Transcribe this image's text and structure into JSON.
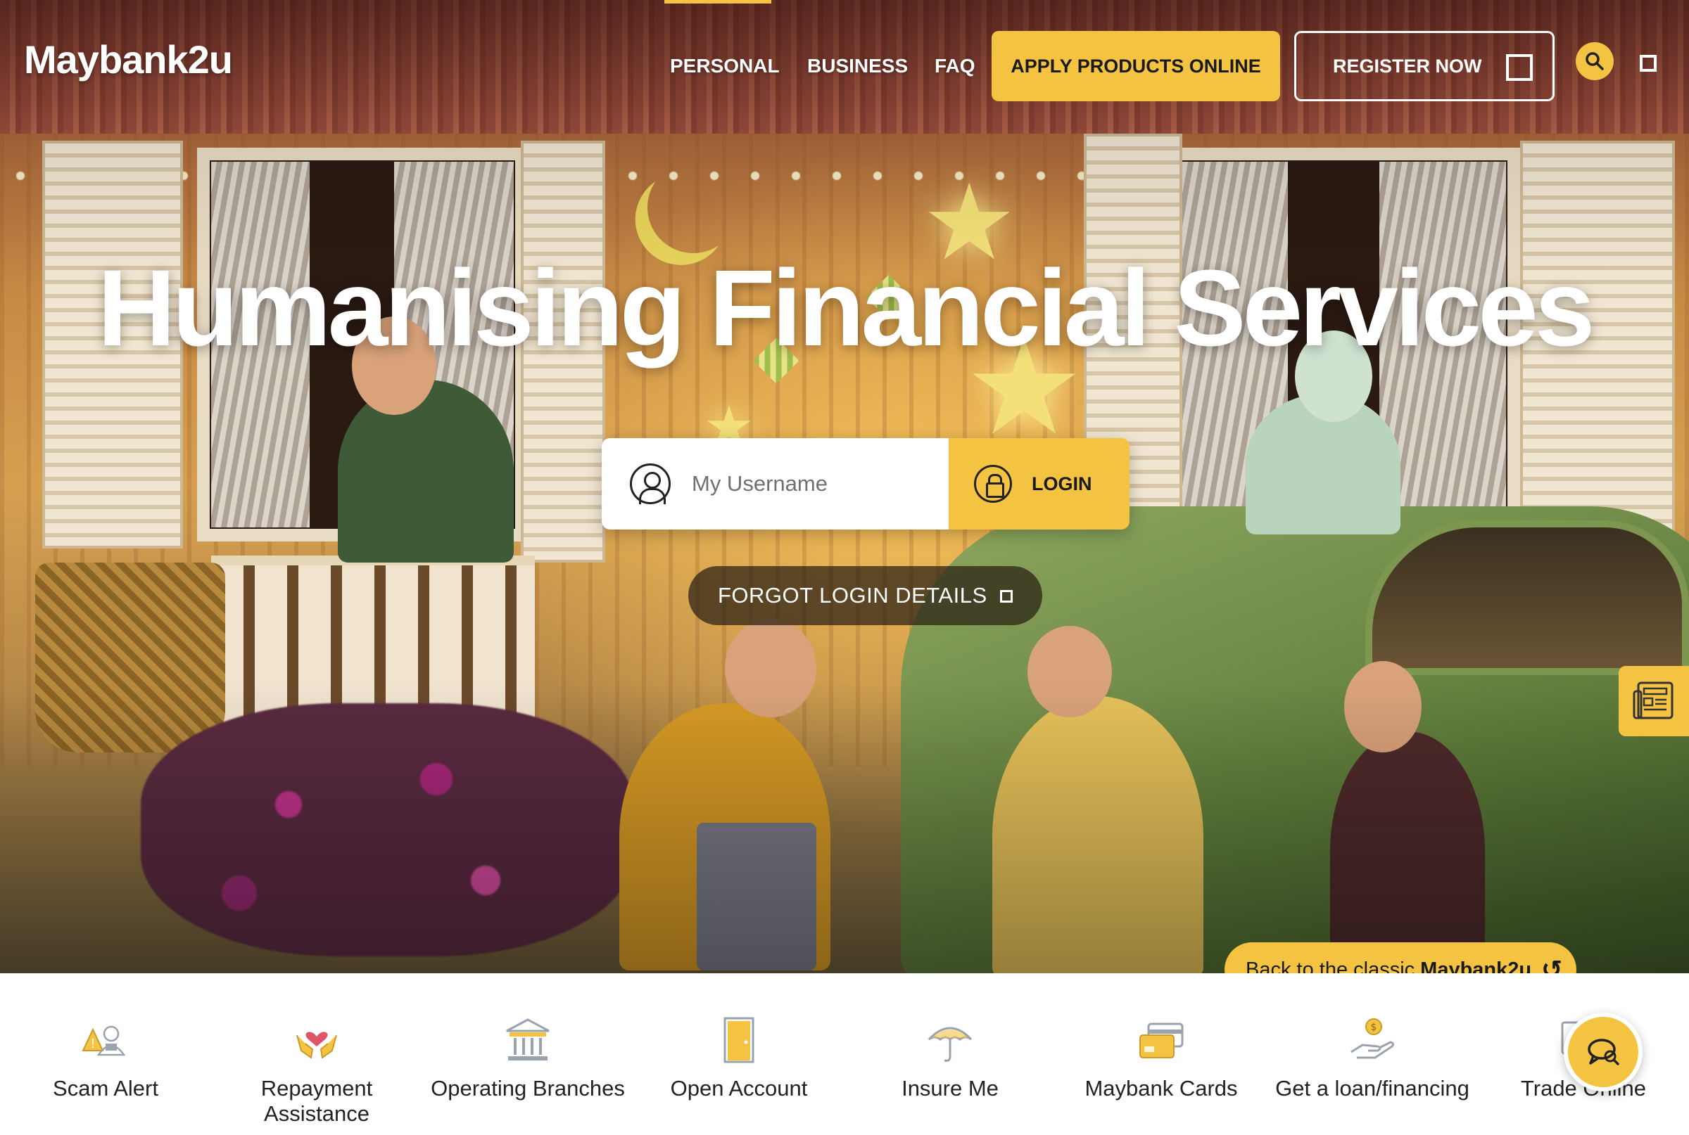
{
  "header": {
    "logo": "Maybank2u",
    "nav": [
      {
        "label": "PERSONAL",
        "active": true
      },
      {
        "label": "BUSINESS"
      },
      {
        "label": "FAQ"
      }
    ],
    "apply_button": "APPLY PRODUCTS ONLINE",
    "register_button": "REGISTER NOW",
    "icons": [
      "square-icon",
      "search-icon",
      "square-icon"
    ]
  },
  "hero": {
    "headline": "Humanising Financial Services",
    "login": {
      "username_placeholder": "My Username",
      "username_value": "",
      "login_button": "LOGIN"
    },
    "forgot_link": "FORGOT LOGIN DETAILS"
  },
  "classic": {
    "prefix": "Back to the classic",
    "brand": "Maybank2u",
    "icon": "undo-icon"
  },
  "quick_links": [
    {
      "label": "Scam Alert",
      "icon": "scam-alert-icon"
    },
    {
      "label": "Repayment Assistance",
      "icon": "heart-hands-icon"
    },
    {
      "label": "Operating Branches",
      "icon": "bank-building-icon"
    },
    {
      "label": "Open Account",
      "icon": "door-icon"
    },
    {
      "label": "Insure Me",
      "icon": "umbrella-icon"
    },
    {
      "label": "Maybank Cards",
      "icon": "cards-icon"
    },
    {
      "label": "Get a loan/financing",
      "icon": "hand-coin-icon"
    },
    {
      "label": "Trade Online",
      "icon": "monitor-icon"
    }
  ],
  "colors": {
    "accent": "#f5c342",
    "text_dark": "#1a1a1a",
    "icon_gold": "#e8b84a",
    "icon_grey": "#9aa3ad"
  }
}
